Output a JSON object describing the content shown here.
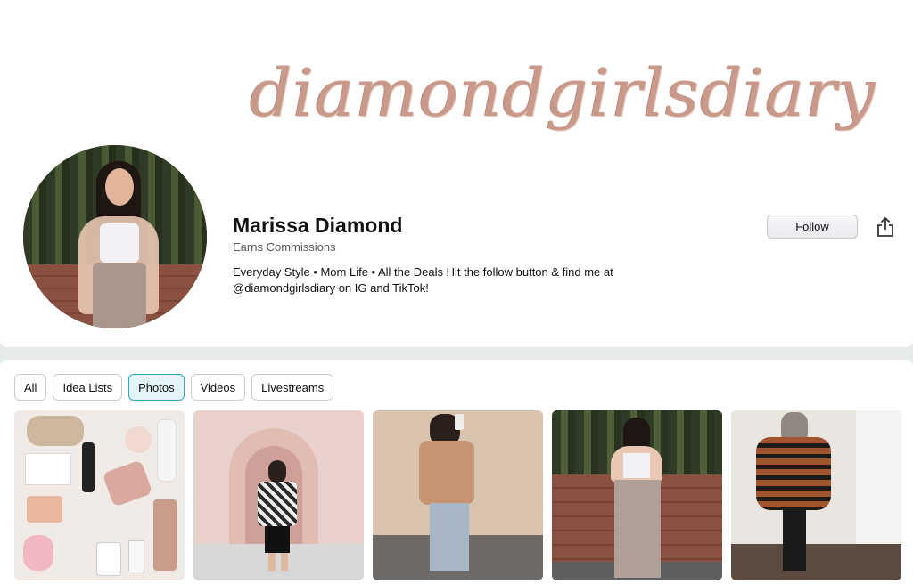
{
  "banner": {
    "text": "diamondgirlsdiary"
  },
  "profile": {
    "name": "Marissa Diamond",
    "earns": "Earns Commissions",
    "bio": "Everyday Style • Mom Life • All the Deals Hit the follow button & find me at @diamondgirlsdiary on IG and TikTok!"
  },
  "actions": {
    "follow_label": "Follow",
    "share_icon": "share-icon"
  },
  "tabs": [
    {
      "label": "All",
      "active": false
    },
    {
      "label": "Idea Lists",
      "active": false
    },
    {
      "label": "Photos",
      "active": true
    },
    {
      "label": "Videos",
      "active": false
    },
    {
      "label": "Livestreams",
      "active": false
    }
  ],
  "photos": [
    {
      "subject": "product-flatlay"
    },
    {
      "subject": "arch-outfit"
    },
    {
      "subject": "blazer-mirror-selfie"
    },
    {
      "subject": "cactus-wall-outfit"
    },
    {
      "subject": "striped-sweater-selfie"
    }
  ],
  "colors": {
    "accent_tab_bg": "#e3f4f8",
    "accent_tab_border": "#2aa6c1",
    "banner_text": "#c99a8c"
  }
}
